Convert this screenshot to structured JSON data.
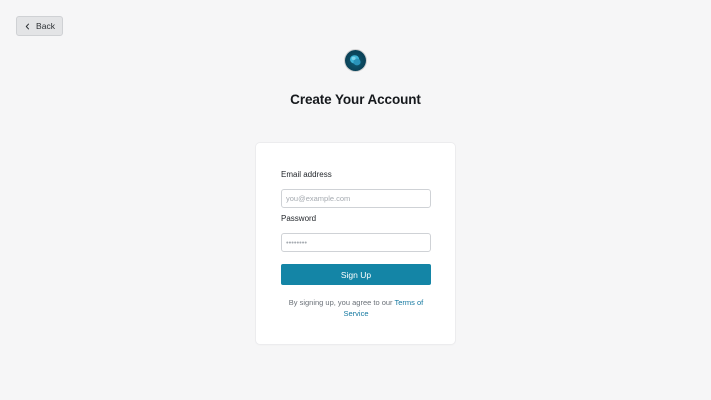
{
  "header": {
    "back_label": "Back",
    "title": "Create Your Account"
  },
  "form": {
    "email_label": "Email address",
    "email_placeholder": "you@example.com",
    "email_value": "",
    "password_label": "Password",
    "password_placeholder": "••••••••",
    "password_value": "",
    "submit_label": "Sign Up",
    "terms_prefix": "By signing up, you agree to our ",
    "terms_link": "Terms of Service"
  },
  "icons": {
    "back": "chevron-left-icon",
    "logo": "globe-logo-icon"
  },
  "colors": {
    "accent": "#1485a6",
    "link": "#1478a0",
    "background": "#f6f6f7",
    "card": "#ffffff",
    "logo": "#0b4359"
  }
}
